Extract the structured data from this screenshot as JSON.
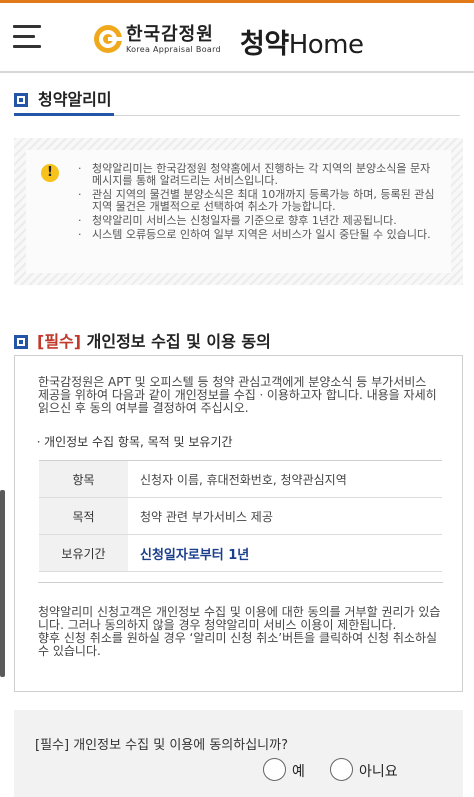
{
  "header": {
    "logo_kor": "한국감정원",
    "logo_eng": "Korea Appraisal Board",
    "title_kor": "청약",
    "title_eng": "Home"
  },
  "section1": {
    "title": "청약알리미",
    "notices": [
      "청약알리미는 한국감정원 청약홈에서 진행하는 각 지역의 분양소식을 문자메시지를 통해 알려드리는 서비스입니다.",
      "관심 지역의 물건별 분양소식은 최대 10개까지 등록가능 하며, 등록된 관심지역 물건은 개별적으로 선택하여 취소가 가능합니다.",
      "청약알리미 서비스는 신청일자를 기준으로 향후 1년간 제공됩니다.",
      "시스템 오류등으로 인하여 일부 지역은 서비스가 일시 중단될 수 있습니다."
    ]
  },
  "section2": {
    "required_tag": "[필수]",
    "title": " 개인정보 수집 및 이용 동의",
    "intro": "한국감정원은 APT 및 오피스텔 등 청약 관심고객에게 분양소식 등 부가서비스 제공을 위하여 다음과 같이 개인정보를 수집ㆍ이용하고자 합니다. 내용을 자세히 읽으신 후 동의 여부를 결정하여 주십시오.",
    "subheading": "ㆍ개인정보 수집 항목, 목적 및 보유기간",
    "table": [
      {
        "label": "항목",
        "value": "신청자 이름, 휴대전화번호, 청약관심지역"
      },
      {
        "label": "목적",
        "value": "청약 관련 부가서비스 제공"
      },
      {
        "label": "보유기간",
        "value": "신청일자로부터 1년"
      }
    ],
    "outro_1": "청약알리미 신청고객은 개인정보 수집 및 이용에 대한 동의를 거부할 권리가 있습니다. 그러나 동의하지 않을 경우 청약알리미 서비스 이용이 제한됩니다.",
    "outro_2": "향후 신청 취소를 원하실 경우 ‘알리미 신청 취소’버튼을 클릭하여 신청 취소하실 수 있습니다."
  },
  "agreement": {
    "question": "[필수] 개인정보 수집 및 이용에 동의하십니까?",
    "yes_label": "예",
    "no_label": "아니요"
  },
  "icons": {
    "menu": "hamburger-menu-icon",
    "warning": "warning-icon",
    "section": "section-square-icon"
  },
  "colors": {
    "accent_orange": "#e27a19",
    "primary_blue": "#2456a8",
    "required_red": "#c0392b",
    "warning_yellow": "#f6c21b"
  }
}
